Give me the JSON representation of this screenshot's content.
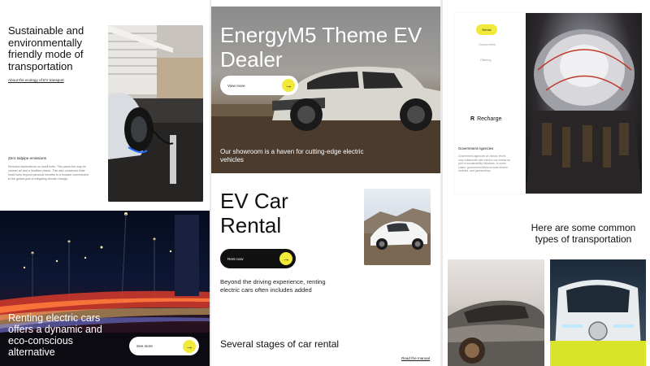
{
  "column1": {
    "title": "Sustainable and environmentally friendly mode of transportation",
    "link": "About the ecology of EV transport",
    "sub_heading": "Zero tailpipe emissions",
    "sub_text": "Reduced dependence on fossil fuels. This paves the way for cleaner air and a healthier planet. This also conserves finite fossil fuels beyond personal benefits to a broader commitment to the global goal of mitigating climate change.",
    "bottom_text": "Renting electric cars offers a dynamic and eco-conscious alternative",
    "bottom_button": "See more",
    "arrow": "→"
  },
  "column2": {
    "hero_title": "EnergyM5 Theme EV Dealer",
    "hero_button": "View more",
    "hero_caption": "Our showroom is a haven for cutting-edge electric vehicles",
    "rental_title": "EV Car Rental",
    "rental_button": "Rent now",
    "description": "Beyond the driving experience, renting electric cars often includes added",
    "stages_title": "Several stages of car rental",
    "manual_link": "Read the manual",
    "arrow": "→"
  },
  "column3": {
    "tag": "Rental",
    "menu_item_1": "Government",
    "menu_item_2": "Offering",
    "brand_mark": "R",
    "brand_name": "Recharge",
    "agency_heading": "Government Agencies",
    "agency_text": "Government agencies at various levels may collaborate with electric car rentals as part of sustainability initiatives. In some cases, government fleets include electric vehicles, and partnerships.",
    "heading": "Here are some common types of transportation"
  },
  "colors": {
    "accent_yellow": "#f2e93a",
    "dark": "#111111",
    "white": "#ffffff"
  },
  "icons": [
    "arrow-right-icon",
    "recharge-logo-icon"
  ]
}
